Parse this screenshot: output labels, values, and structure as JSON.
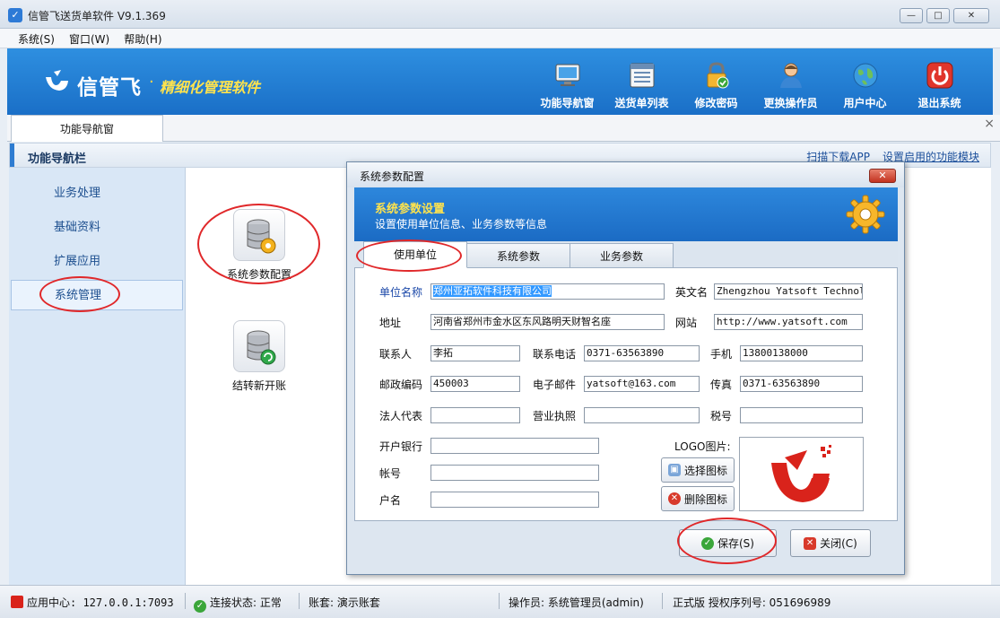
{
  "window": {
    "title": "信管飞送货单软件 V9.1.369",
    "controls": {
      "minimize": "—",
      "maximize": "□",
      "close": "✕"
    }
  },
  "menu": [
    {
      "label": "系统(S)"
    },
    {
      "label": "窗口(W)"
    },
    {
      "label": "帮助(H)"
    }
  ],
  "header": {
    "logo_text": "信管飞",
    "logo_dot": "·",
    "slogan": "精细化管理软件",
    "toolbar": [
      {
        "label": "功能导航窗",
        "icon": "monitor-icon"
      },
      {
        "label": "送货单列表",
        "icon": "list-icon"
      },
      {
        "label": "修改密码",
        "icon": "lock-icon"
      },
      {
        "label": "更换操作员",
        "icon": "user-icon"
      },
      {
        "label": "用户中心",
        "icon": "globe-icon"
      },
      {
        "label": "退出系统",
        "icon": "power-icon"
      }
    ]
  },
  "tabs": {
    "active": "功能导航窗",
    "close": "×"
  },
  "nav": {
    "title": "功能导航栏",
    "links": [
      "扫描下载APP",
      "设置启用的功能模块"
    ]
  },
  "sidebar": {
    "items": [
      {
        "label": "业务处理"
      },
      {
        "label": "基础资料"
      },
      {
        "label": "扩展应用"
      },
      {
        "label": "系统管理"
      }
    ]
  },
  "functions": [
    {
      "label": "系统参数配置",
      "icon": "database-gear-icon"
    },
    {
      "label": "结转新开账",
      "icon": "database-refresh-icon"
    }
  ],
  "dialog": {
    "title": "系统参数配置",
    "close": "✕",
    "banner_title": "系统参数设置",
    "banner_subtitle": "设置使用单位信息、业务参数等信息",
    "tabs": [
      "使用单位",
      "系统参数",
      "业务参数"
    ],
    "form": {
      "unit_name_label": "单位名称",
      "unit_name": "郑州亚拓软件科技有限公司",
      "english_name_label": "英文名",
      "english_name": "Zhengzhou Yatsoft Technolog",
      "address_label": "地址",
      "address": "河南省郑州市金水区东风路明天财智名座",
      "website_label": "网站",
      "website": "http://www.yatsoft.com",
      "contact_label": "联系人",
      "contact": "李拓",
      "phone_label": "联系电话",
      "phone": "0371-63563890",
      "mobile_label": "手机",
      "mobile": "13800138000",
      "postcode_label": "邮政编码",
      "postcode": "450003",
      "email_label": "电子邮件",
      "email": "yatsoft@163.com",
      "fax_label": "传真",
      "fax": "0371-63563890",
      "legal_rep_label": "法人代表",
      "legal_rep": "",
      "license_label": "营业执照",
      "license": "",
      "tax_label": "税号",
      "tax": "",
      "bank_label": "开户银行",
      "bank": "",
      "account_label": "帐号",
      "account": "",
      "account_name_label": "户名",
      "account_name": "",
      "logo_label": "LOGO图片:",
      "choose_icon": "选择图标",
      "delete_icon": "删除图标"
    },
    "save": "保存(S)",
    "close_button": "关闭(C)"
  },
  "statusbar": {
    "app_center": "应用中心: 127.0.0.1:7093",
    "connection": "连接状态: 正常",
    "account_set": "账套: 演示账套",
    "operator": "操作员: 系统管理员(admin)",
    "license": "正式版 授权序列号: 051696989"
  },
  "colors": {
    "banner_blue": "#1a6fc7",
    "slogan_yellow": "#ffe34d",
    "highlight_red": "#e0282a",
    "link_blue": "#1a4e9a"
  }
}
